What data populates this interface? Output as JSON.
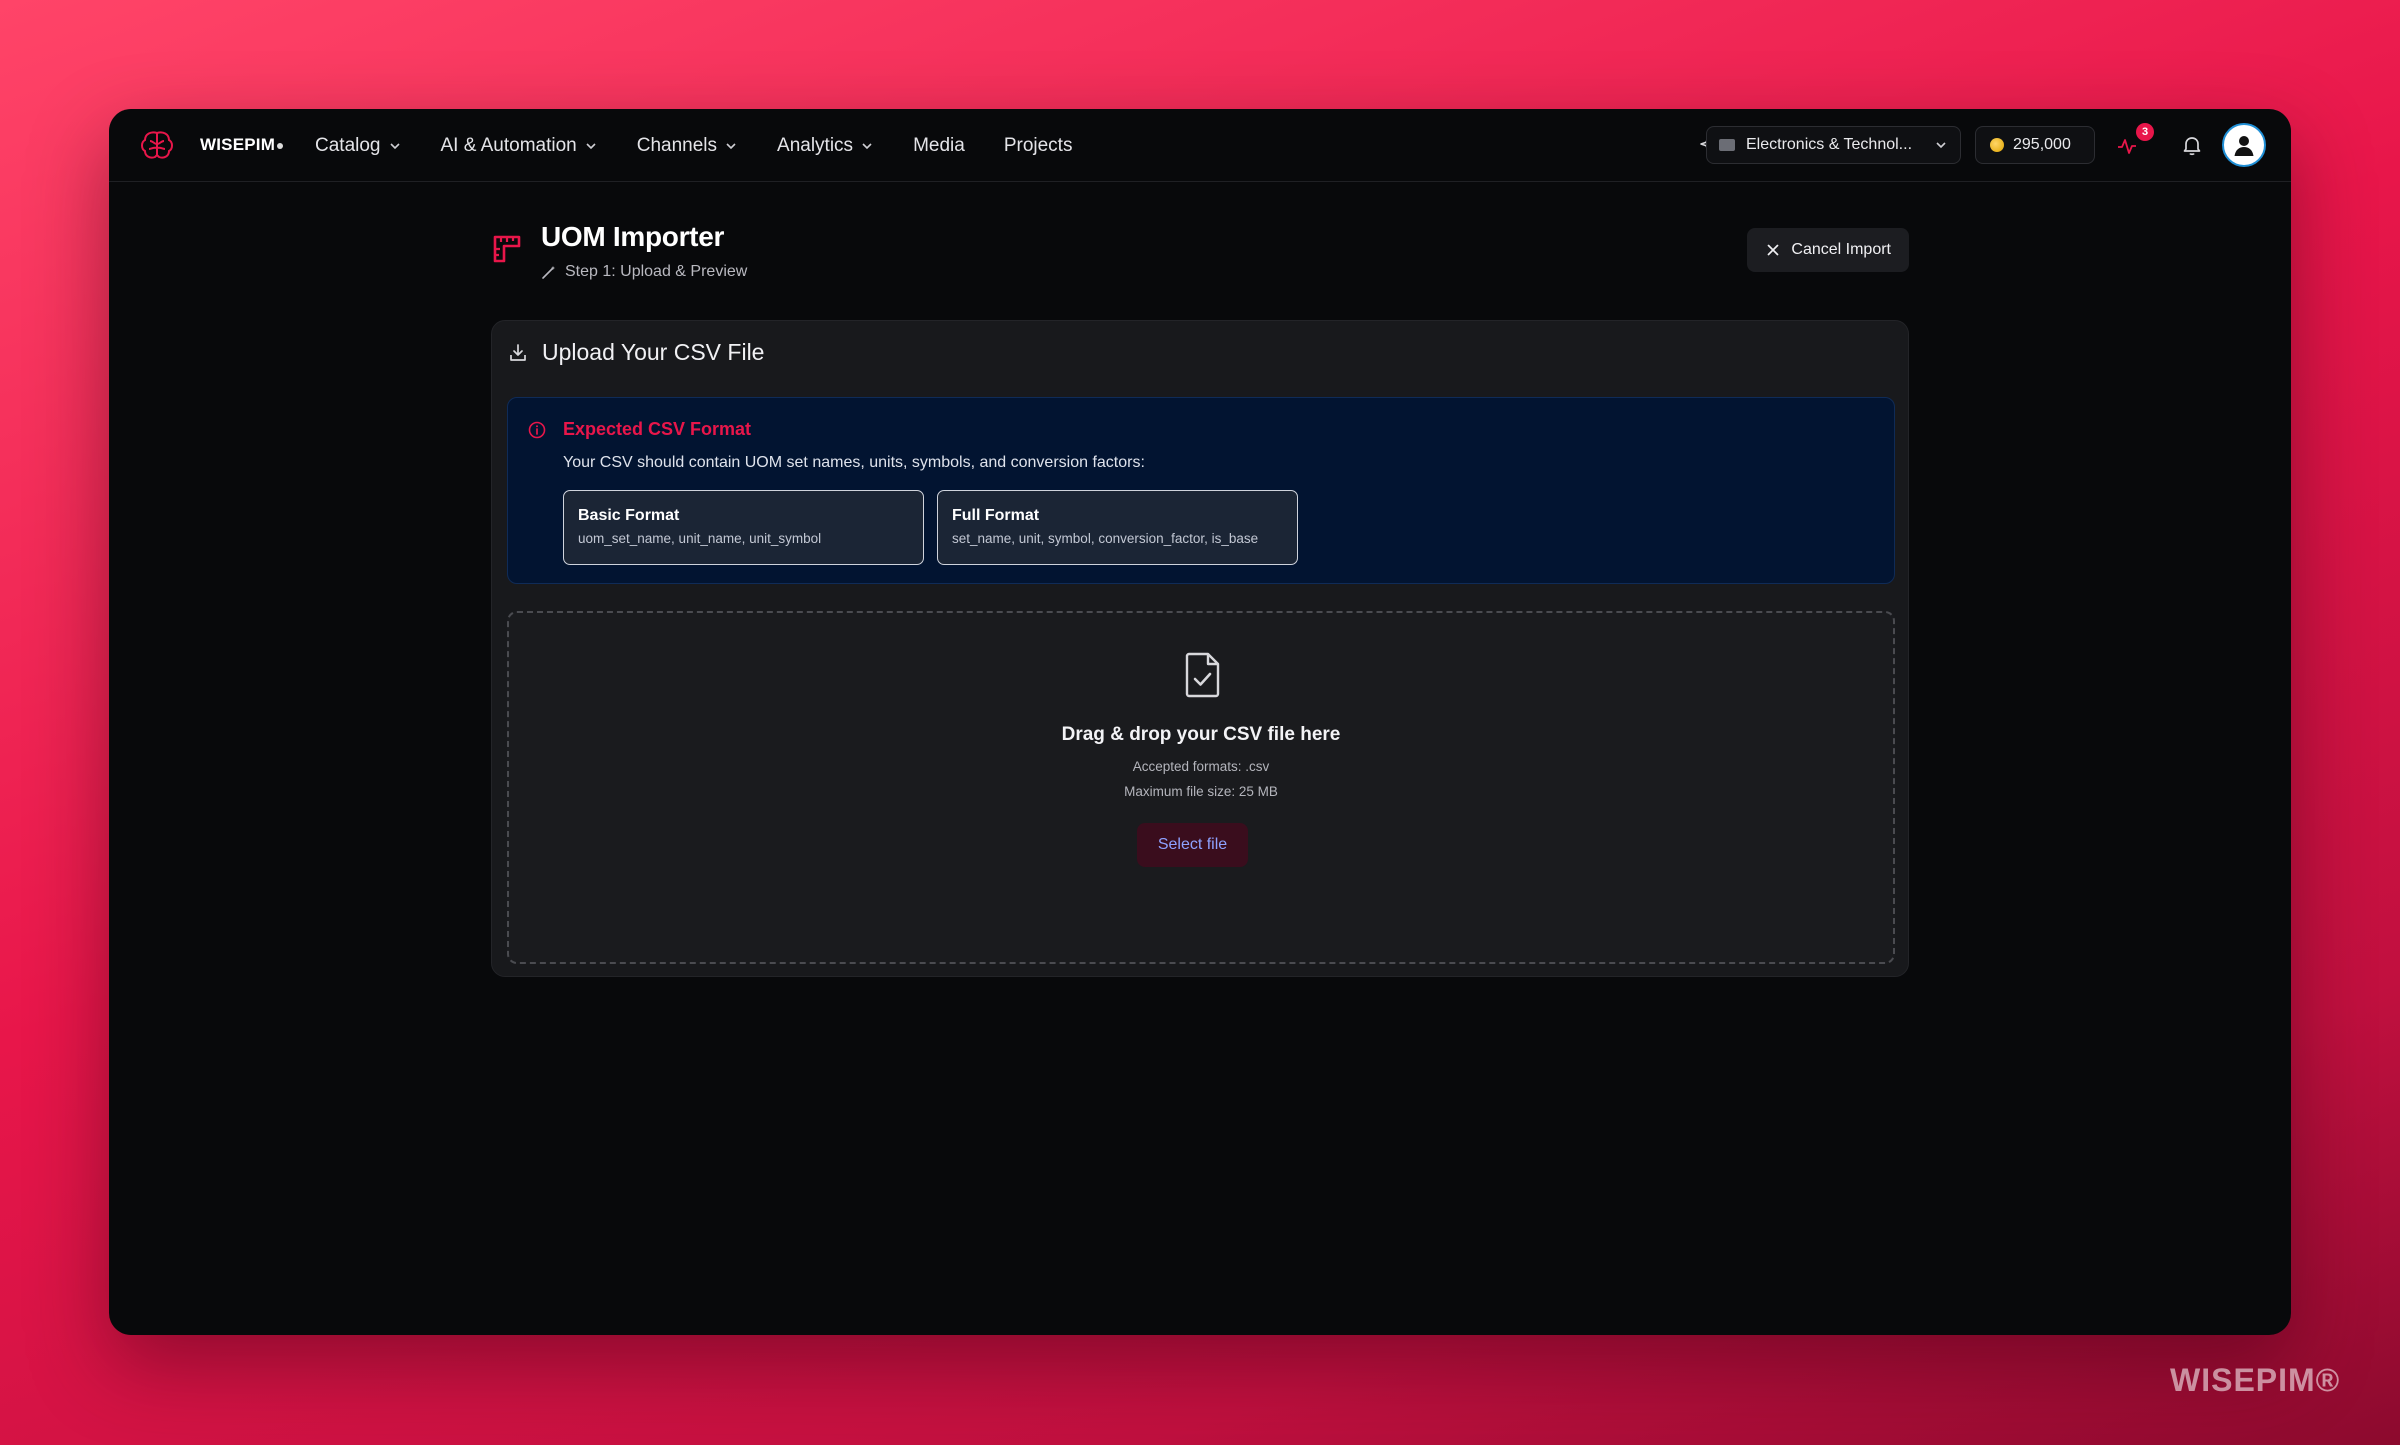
{
  "brand": {
    "name": "WISEPIM"
  },
  "nav": {
    "items": [
      {
        "label": "Catalog",
        "dropdown": true
      },
      {
        "label": "AI & Automation",
        "dropdown": true
      },
      {
        "label": "Channels",
        "dropdown": true
      },
      {
        "label": "Analytics",
        "dropdown": true
      },
      {
        "label": "Media",
        "dropdown": false
      },
      {
        "label": "Projects",
        "dropdown": false
      }
    ],
    "catalog_select": "Electronics & Technol...",
    "credits": "295,000",
    "notification_badge": "3"
  },
  "header": {
    "title": "UOM Importer",
    "step": "Step 1: Upload & Preview",
    "cancel_label": "Cancel Import"
  },
  "card": {
    "title": "Upload Your CSV File",
    "format_info": {
      "title": "Expected CSV Format",
      "description": "Your CSV should contain UOM set names, units, symbols, and conversion factors:",
      "formats": [
        {
          "name": "Basic Format",
          "columns": "uom_set_name, unit_name, unit_symbol"
        },
        {
          "name": "Full Format",
          "columns": "set_name, unit, symbol, conversion_factor, is_base"
        }
      ]
    },
    "dropzone": {
      "title": "Drag & drop your CSV file here",
      "accepted": "Accepted formats: .csv",
      "max_size": "Maximum file size: 25 MB",
      "button_label": "Select file"
    }
  },
  "watermark": "WISEPIM®",
  "colors": {
    "accent": "#e8164a",
    "info_bg": "#021431",
    "link": "#8ea2ff"
  }
}
